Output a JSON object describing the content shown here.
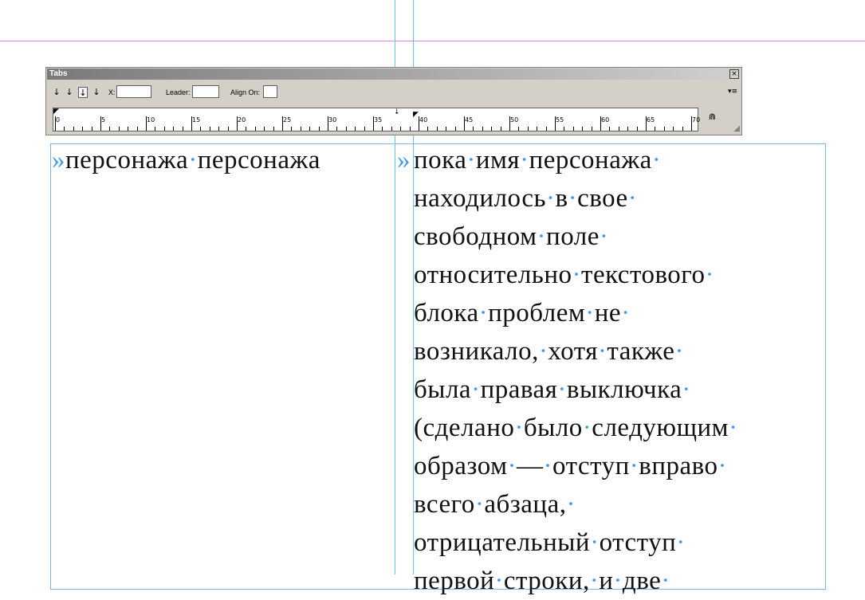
{
  "panel": {
    "title": "Tabs",
    "close_label": "×",
    "tab_buttons": [
      {
        "icon": "left-justified-tab-icon",
        "glyph": "↓"
      },
      {
        "icon": "center-justified-tab-icon",
        "glyph": "↓"
      },
      {
        "icon": "right-justified-tab-icon",
        "glyph": "↓"
      },
      {
        "icon": "align-to-decimal-tab-icon",
        "glyph": "↓"
      }
    ],
    "x_label": "X:",
    "x_value": "",
    "leader_label": "Leader:",
    "leader_value": "",
    "align_on_label": "Align On:",
    "align_on_value": "",
    "menu_glyph": "▾≡",
    "magnet_glyph": "⋒",
    "grip_glyph": "◢",
    "ruler_labels": [
      "0",
      "5",
      "10",
      "15",
      "20",
      "25",
      "30",
      "35",
      "40",
      "45",
      "50",
      "55",
      "60",
      "65",
      "70"
    ]
  },
  "document": {
    "left_column": {
      "tab_char": "»",
      "words": [
        "персонажа",
        "персонажа"
      ]
    },
    "right_column_tab": "»",
    "right_lines": [
      "пока имя персонажа",
      "находилось в свое",
      "свободном поле",
      "относительно текстового",
      "блока проблем не",
      "возникало, хотя также",
      "была правая выключка",
      "(сделано было следующим",
      "образом — отступ вправо",
      "всего абзаца,",
      "отрицательный отступ",
      "первой строки, и две"
    ]
  },
  "colors": {
    "guide_magenta": "#e27be6",
    "guide_cyan": "#5ccfe6",
    "frame_blue": "#7ab6e8",
    "hidden_char_blue": "#4a9be6",
    "panel_gray": "#d4d0c8"
  }
}
